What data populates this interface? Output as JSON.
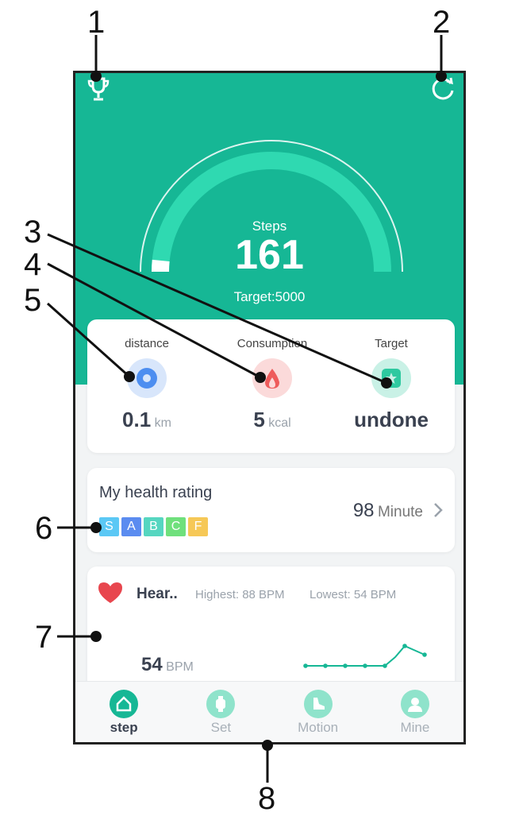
{
  "callouts": [
    "1",
    "2",
    "3",
    "4",
    "5",
    "6",
    "7",
    "8"
  ],
  "colors": {
    "primary": "#16b795",
    "arc_light": "#2fd9b1",
    "heart": "#e8464e",
    "grade_S": "#5bc8f5",
    "grade_A": "#5b8cf0",
    "grade_B": "#56d6c0",
    "grade_C": "#6fe07c",
    "grade_F": "#f6c857"
  },
  "header": {
    "left_icon": "trophy-icon",
    "right_icon": "refresh-icon"
  },
  "steps": {
    "label": "Steps",
    "value": "161",
    "target_text": "Target:5000",
    "progress_fraction": 0.032
  },
  "stats": {
    "distance": {
      "label": "distance",
      "value": "0.1",
      "unit": "km",
      "icon": "location-pin-icon"
    },
    "consumption": {
      "label": "Consumption",
      "value": "5",
      "unit": "kcal",
      "icon": "flame-icon"
    },
    "target": {
      "label": "Target",
      "value": "undone",
      "icon": "star-badge-icon"
    }
  },
  "health_rating": {
    "title": "My health rating",
    "grades": [
      "S",
      "A",
      "B",
      "C",
      "F"
    ],
    "minutes_value": "98",
    "minutes_unit": "Minute",
    "chevron": "chevron-right-icon"
  },
  "heart": {
    "title": "Hear..",
    "highest": "Highest: 88 BPM",
    "lowest": "Lowest: 54 BPM",
    "current_value": "54",
    "current_unit": "BPM",
    "icon": "heart-icon"
  },
  "nav": [
    {
      "label": "step",
      "icon": "home-icon",
      "active": true
    },
    {
      "label": "Set",
      "icon": "watch-icon",
      "active": false
    },
    {
      "label": "Motion",
      "icon": "shoe-icon",
      "active": false
    },
    {
      "label": "Mine",
      "icon": "user-icon",
      "active": false
    }
  ]
}
